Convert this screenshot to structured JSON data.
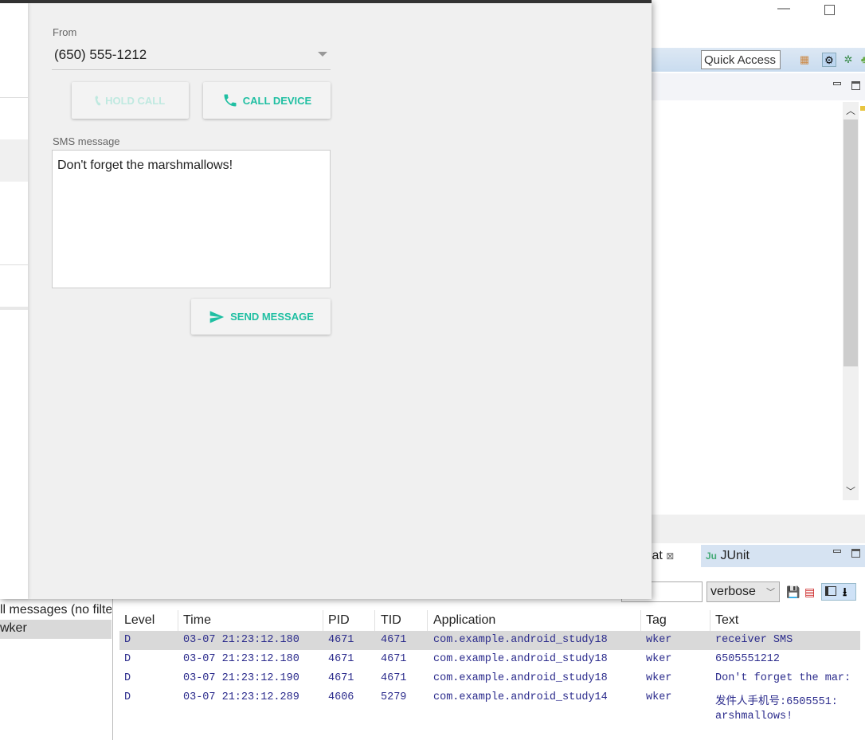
{
  "ide": {
    "quick_access": "Quick Access",
    "tabs": [
      {
        "label": "gCat",
        "close": "⊠"
      },
      {
        "label": "JUnit",
        "icon": "Ju"
      }
    ],
    "filter_placeholder": "e.",
    "log_level": "verbose",
    "filters": [
      "ll messages (no filte",
      "wker"
    ],
    "columns": [
      "Level",
      "Time",
      "PID",
      "TID",
      "Application",
      "Tag",
      "Text"
    ],
    "rows": [
      {
        "level": "D",
        "time": "03-07 21:23:12.180",
        "pid": "4671",
        "tid": "4671",
        "app": "com.example.android_study18",
        "tag": "wker",
        "text": "receiver SMS"
      },
      {
        "level": "D",
        "time": "03-07 21:23:12.180",
        "pid": "4671",
        "tid": "4671",
        "app": "com.example.android_study18",
        "tag": "wker",
        "text": "6505551212"
      },
      {
        "level": "D",
        "time": "03-07 21:23:12.190",
        "pid": "4671",
        "tid": "4671",
        "app": "com.example.android_study18",
        "tag": "wker",
        "text": "Don't forget the mar:"
      },
      {
        "level": "D",
        "time": "03-07 21:23:12.289",
        "pid": "4606",
        "tid": "5279",
        "app": "com.example.android_study14",
        "tag": "wker",
        "text": "发件人手机号:6505551:"
      }
    ],
    "continuation": "arshmallows!"
  },
  "emulator": {
    "from_label": "From",
    "from_value": "(650) 555-1212",
    "hold_call": "HOLD CALL",
    "call_device": "CALL DEVICE",
    "sms_label": "SMS message",
    "sms_value": "Don't forget the marshmallows!",
    "send_message": "SEND MESSAGE",
    "accent": "#1fbfa2"
  }
}
